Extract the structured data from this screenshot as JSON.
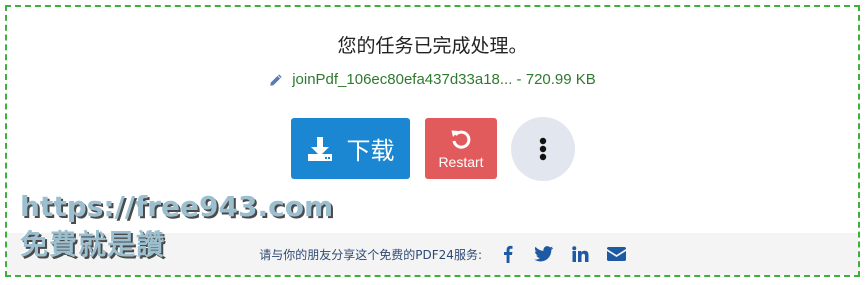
{
  "message": "您的任务已完成处理。",
  "file": {
    "name": "joinPdf_106ec80efa437d33a18...",
    "separator": " - ",
    "size": "720.99 KB",
    "icon": "pencil-icon"
  },
  "buttons": {
    "download_label": "下载",
    "restart_label": "Restart",
    "download_color": "#1b86d1",
    "restart_color": "#e15b5d"
  },
  "share": {
    "text": "请与你的朋友分享这个免费的PDF24服务:",
    "icons": [
      "facebook-icon",
      "twitter-icon",
      "linkedin-icon",
      "email-icon"
    ]
  },
  "watermark": {
    "line1": "https://free943.com",
    "line2": "免費就是讚"
  }
}
